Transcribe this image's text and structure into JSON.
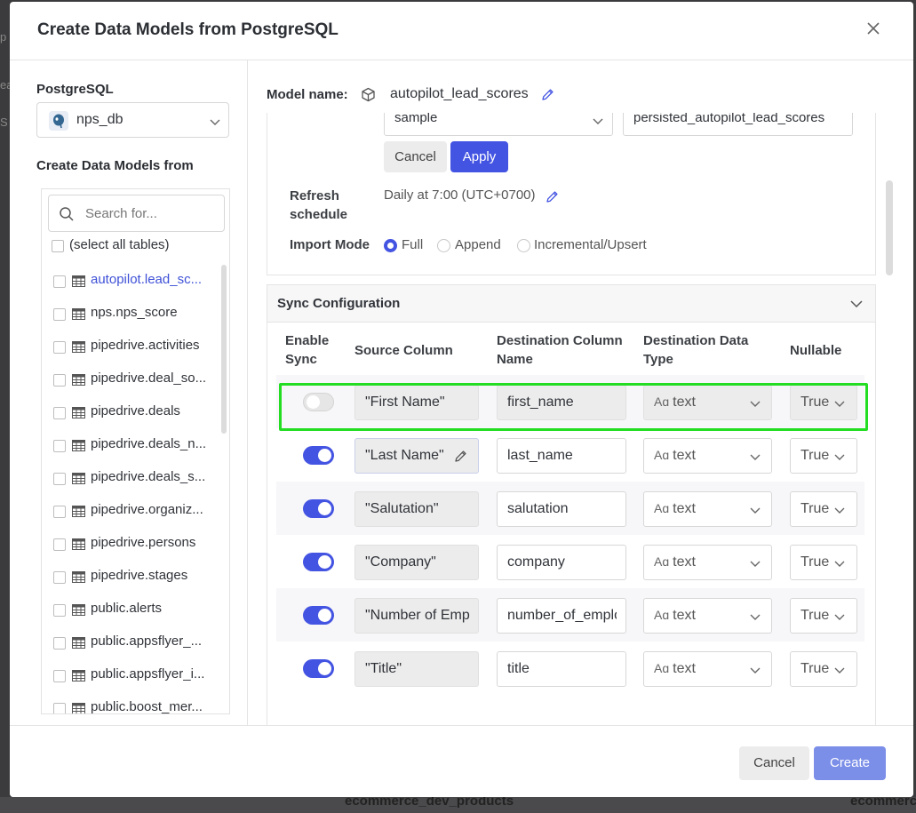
{
  "backdrop": {
    "left_fragments": [
      "p",
      "ea",
      "S"
    ],
    "bottom_text": "ecommerce_dev_products",
    "bottom_right_text": "ecommerc"
  },
  "modal": {
    "title": "Create Data Models from PostgreSQL",
    "close_icon": "close-icon"
  },
  "source": {
    "label": "PostgreSQL",
    "db_value": "nps_db",
    "create_from_label": "Create Data Models from",
    "search_placeholder": "Search for...",
    "select_all_label": "(select all tables)",
    "tables": [
      {
        "name": "autopilot.lead_sc...",
        "active": true
      },
      {
        "name": "nps.nps_score",
        "active": false
      },
      {
        "name": "pipedrive.activities",
        "active": false
      },
      {
        "name": "pipedrive.deal_so...",
        "active": false
      },
      {
        "name": "pipedrive.deals",
        "active": false
      },
      {
        "name": "pipedrive.deals_n...",
        "active": false
      },
      {
        "name": "pipedrive.deals_s...",
        "active": false
      },
      {
        "name": "pipedrive.organiz...",
        "active": false
      },
      {
        "name": "pipedrive.persons",
        "active": false
      },
      {
        "name": "pipedrive.stages",
        "active": false
      },
      {
        "name": "public.alerts",
        "active": false
      },
      {
        "name": "public.appsflyer_...",
        "active": false
      },
      {
        "name": "public.appsflyer_i...",
        "active": false
      },
      {
        "name": "public.boost_mer...",
        "active": false
      }
    ]
  },
  "model": {
    "label": "Model name:",
    "name": "autopilot_lead_scores",
    "schema_value": "sample",
    "table_value": "persisted_autopilot_lead_scores",
    "cancel_label": "Cancel",
    "apply_label": "Apply",
    "refresh_label": "Refresh schedule",
    "refresh_value": "Daily at 7:00 (UTC+0700)",
    "import_mode_label": "Import Mode",
    "import_modes": [
      "Full",
      "Append",
      "Incremental/Upsert"
    ],
    "import_mode_selected": "Full"
  },
  "sync": {
    "title": "Sync Configuration",
    "headers": {
      "enable": "Enable Sync",
      "source": "Source Column",
      "destination": "Destination Column Name",
      "type": "Destination Data Type",
      "nullable": "Nullable"
    },
    "type_prefix": "Aɑ",
    "rows": [
      {
        "enabled": false,
        "source": "\"First Name\"",
        "destination": "first_name",
        "type": "text",
        "nullable": "True"
      },
      {
        "enabled": true,
        "source": "\"Last Name\"",
        "destination": "last_name",
        "type": "text",
        "nullable": "True"
      },
      {
        "enabled": true,
        "source": "\"Salutation\"",
        "destination": "salutation",
        "type": "text",
        "nullable": "True"
      },
      {
        "enabled": true,
        "source": "\"Company\"",
        "destination": "company",
        "type": "text",
        "nullable": "True"
      },
      {
        "enabled": true,
        "source": "\"Number of Emp",
        "destination": "number_of_emplo",
        "type": "text",
        "nullable": "True"
      },
      {
        "enabled": true,
        "source": "\"Title\"",
        "destination": "title",
        "type": "text",
        "nullable": "True"
      }
    ]
  },
  "footer": {
    "cancel_label": "Cancel",
    "create_label": "Create"
  },
  "colors": {
    "accent": "#4454e2",
    "highlight": "#22dd22",
    "create_disabled": "#7b8ee8"
  }
}
